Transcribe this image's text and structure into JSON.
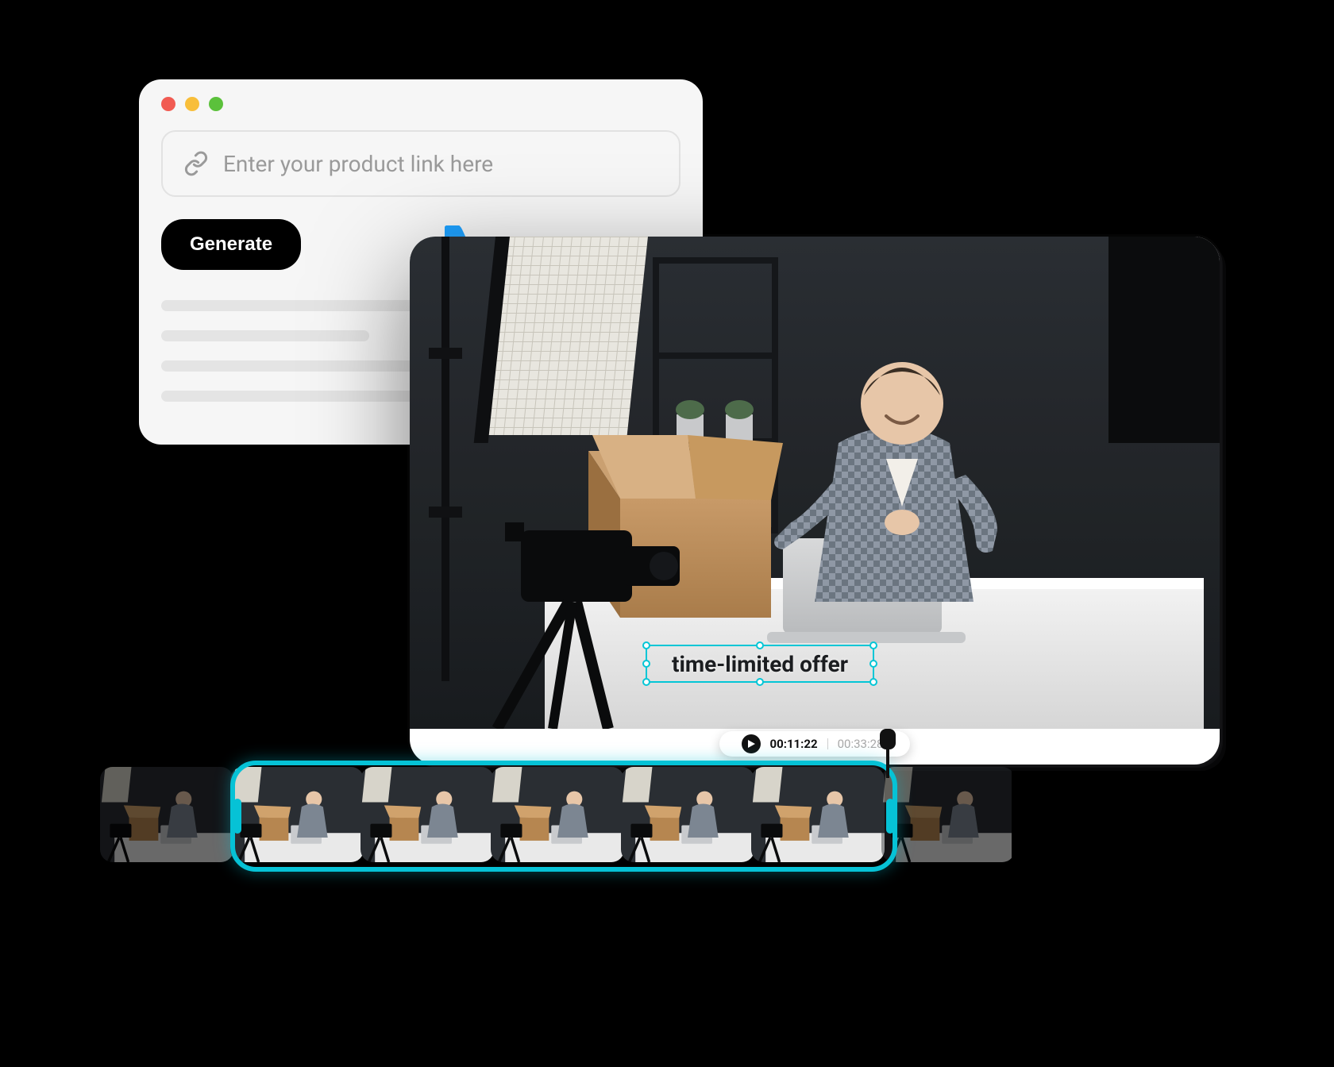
{
  "input_card": {
    "placeholder": "Enter your product link here",
    "generate_label": "Generate"
  },
  "preview": {
    "caption_text": "time-limited offer",
    "current_time": "00:11:22",
    "total_time": "00:33:28"
  },
  "timeline": {
    "clip_count": 7,
    "selection_start_index": 1,
    "selection_end_index": 5
  },
  "colors": {
    "accent": "#06c2d6",
    "arrow": "#1ea1ff"
  }
}
